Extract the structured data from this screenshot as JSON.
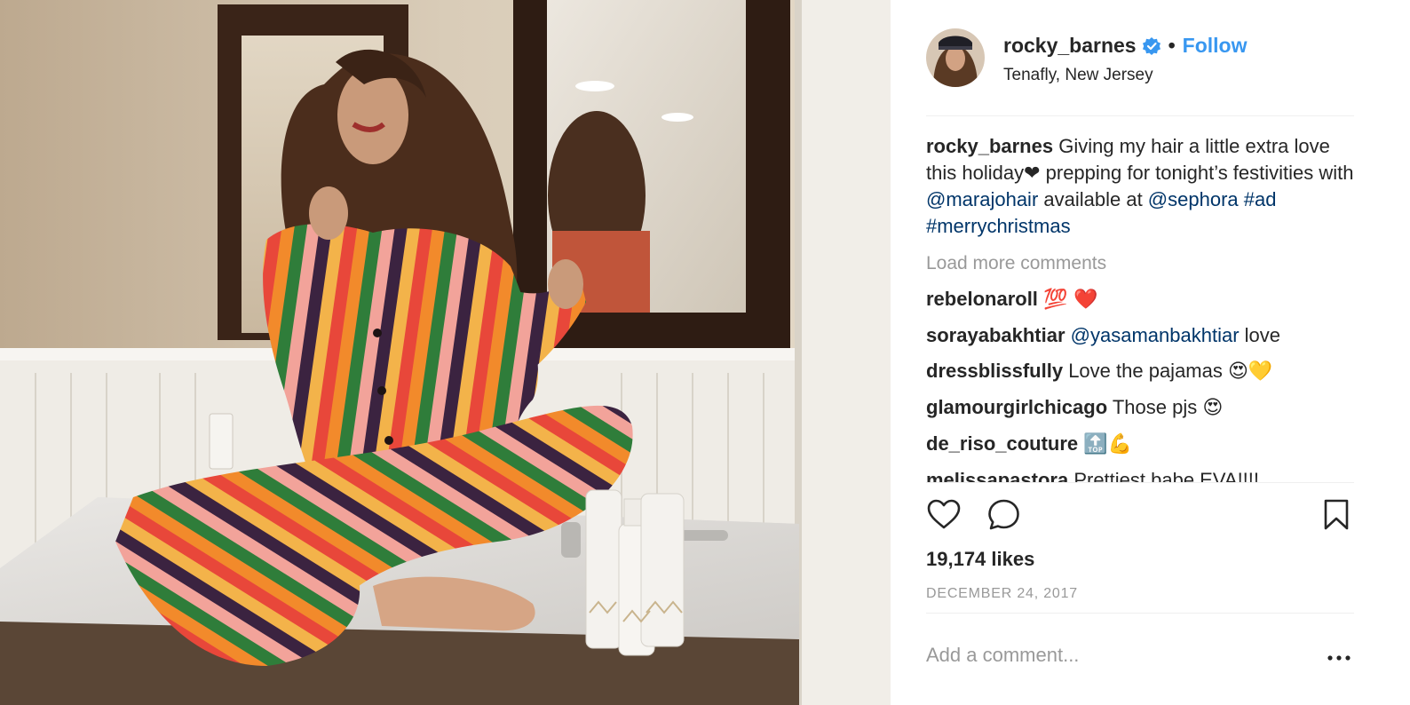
{
  "header": {
    "username": "rocky_barnes",
    "verified_icon": "verified-badge-icon",
    "separator": "•",
    "follow_label": "Follow",
    "location": "Tenafly, New Jersey"
  },
  "caption": {
    "username": "rocky_barnes",
    "text_1": " Giving my hair a little extra love this holiday",
    "heart": "❤",
    "text_2": " prepping for tonight’s festivities with ",
    "mention_1": "@marajohair",
    "text_3": " available at ",
    "mention_2": "@sephora",
    "text_4": " ",
    "hashtag_1": "#ad",
    "text_5": " ",
    "hashtag_2": "#merrychristmas"
  },
  "load_more": "Load more comments",
  "comments": [
    {
      "username": "rebelonaroll",
      "text": "",
      "emoji": "💯 ❤️"
    },
    {
      "username": "sorayabakhtiar",
      "mention": "@yasamanbakhtiar",
      "text": " love"
    },
    {
      "username": "dressblissfully",
      "text": " Love the pajamas ",
      "emoji": "😍💛"
    },
    {
      "username": "glamourgirlchicago",
      "text": " Those pjs ",
      "emoji": "😍"
    },
    {
      "username": "de_riso_couture",
      "text": " ",
      "emoji": "🔝💪"
    },
    {
      "username": "melissapastora",
      "text": " Prettiest babe EVA!!!!"
    }
  ],
  "actions": {
    "like_icon": "heart-outline-icon",
    "comment_icon": "comment-bubble-icon",
    "save_icon": "bookmark-icon"
  },
  "likes": "19,174 likes",
  "date": "DECEMBER 24, 2017",
  "add_comment": {
    "placeholder": "Add a comment...",
    "value": ""
  },
  "more_icon": "ellipsis-icon",
  "colors": {
    "link": "#003569",
    "follow": "#3897f0",
    "muted": "#999999",
    "text": "#262626",
    "divider": "#efefef"
  }
}
